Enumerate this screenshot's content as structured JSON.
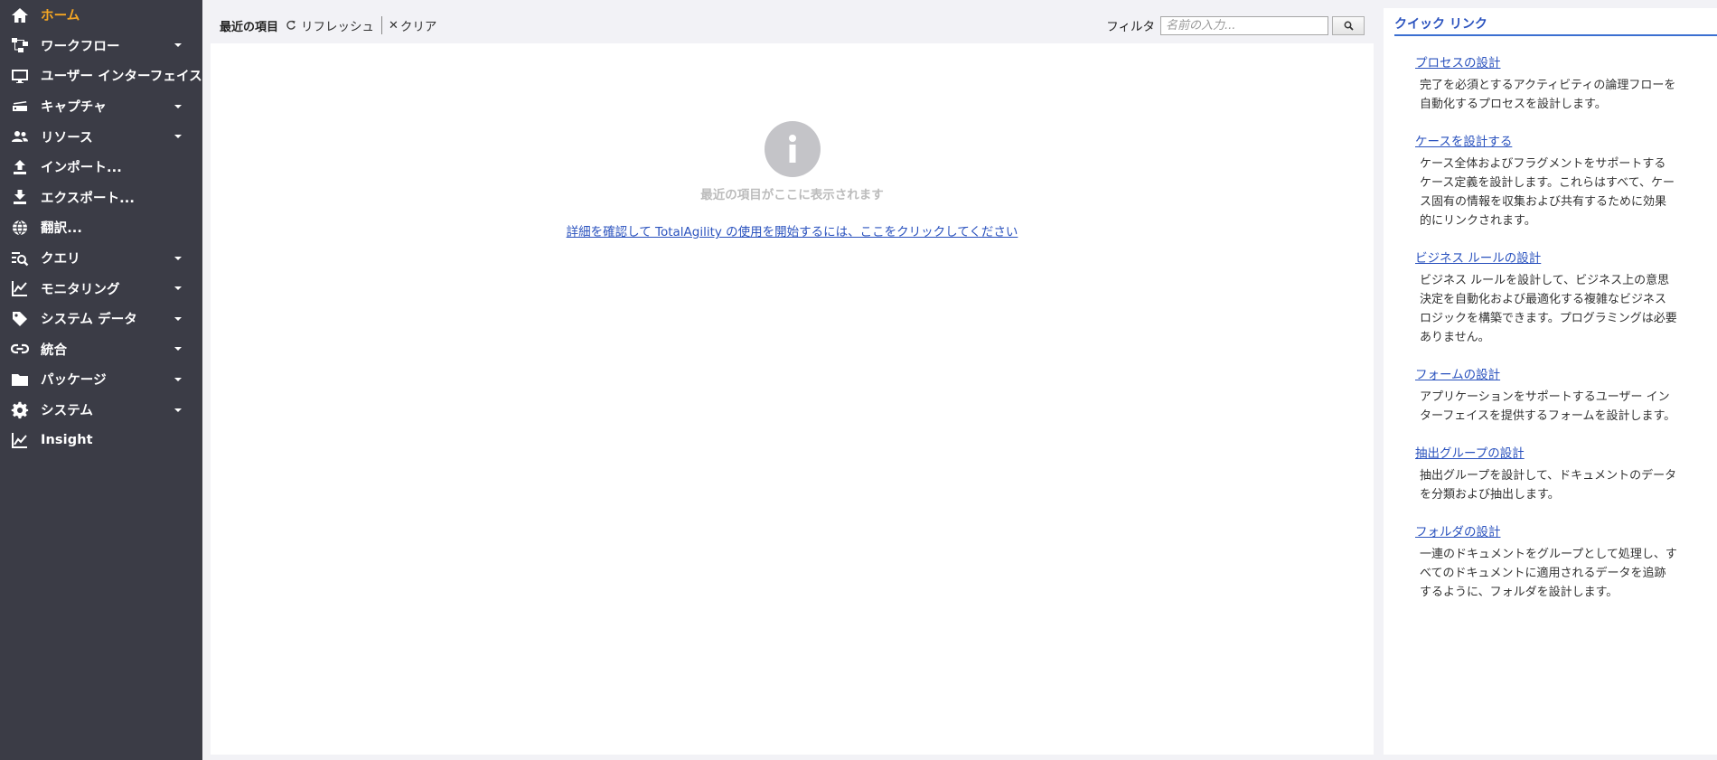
{
  "sidebar": {
    "items": [
      {
        "label": "ホーム",
        "icon": "home-icon",
        "active": true,
        "has_caret": false
      },
      {
        "label": "ワークフロー",
        "icon": "workflow-icon",
        "active": false,
        "has_caret": true
      },
      {
        "label": "ユーザー インターフェイス",
        "icon": "monitor-icon",
        "active": false,
        "has_caret": false
      },
      {
        "label": "キャプチャ",
        "icon": "scanner-icon",
        "active": false,
        "has_caret": true
      },
      {
        "label": "リソース",
        "icon": "people-icon",
        "active": false,
        "has_caret": true
      },
      {
        "label": "インポート...",
        "icon": "upload-icon",
        "active": false,
        "has_caret": false
      },
      {
        "label": "エクスポート...",
        "icon": "download-icon",
        "active": false,
        "has_caret": false
      },
      {
        "label": "翻訳...",
        "icon": "globe-icon",
        "active": false,
        "has_caret": false
      },
      {
        "label": "クエリ",
        "icon": "query-icon",
        "active": false,
        "has_caret": true
      },
      {
        "label": "モニタリング",
        "icon": "chart-line-icon",
        "active": false,
        "has_caret": true
      },
      {
        "label": "システム データ",
        "icon": "tag-icon",
        "active": false,
        "has_caret": true
      },
      {
        "label": "統合",
        "icon": "link-icon",
        "active": false,
        "has_caret": true
      },
      {
        "label": "パッケージ",
        "icon": "folder-icon",
        "active": false,
        "has_caret": true
      },
      {
        "label": "システム",
        "icon": "gear-icon",
        "active": false,
        "has_caret": true
      },
      {
        "label": "Insight",
        "icon": "insight-icon",
        "active": false,
        "has_caret": false
      }
    ]
  },
  "toolbar": {
    "title": "最近の項目",
    "refresh_label": "リフレッシュ",
    "clear_label": "クリア",
    "filter_label": "フィルタ",
    "filter_placeholder": "名前の入力...",
    "filter_value": ""
  },
  "main": {
    "empty_text": "最近の項目がここに表示されます",
    "help_link": "詳細を確認して TotalAgility の使用を開始するには、ここをクリックしてください"
  },
  "quick_links": {
    "title": "クイック リンク",
    "items": [
      {
        "link": "プロセスの設計",
        "desc": "完了を必須とするアクティビティの論理フローを自動化するプロセスを設計します。"
      },
      {
        "link": "ケースを設計する",
        "desc": "ケース全体およびフラグメントをサポートするケース定義を設計します。これらはすべて、ケース固有の情報を収集および共有するために効果的にリンクされます。"
      },
      {
        "link": "ビジネス ルールの設計",
        "desc": "ビジネス ルールを設計して、ビジネス上の意思決定を自動化および最適化する複雑なビジネス ロジックを構築できます。プログラミングは必要ありません。"
      },
      {
        "link": "フォームの設計",
        "desc": "アプリケーションをサポートするユーザー インターフェイスを提供するフォームを設計します。"
      },
      {
        "link": "抽出グループの設計",
        "desc": "抽出グループを設計して、ドキュメントのデータを分類および抽出します。"
      },
      {
        "link": "フォルダの設計",
        "desc": "一連のドキュメントをグループとして処理し、すべてのドキュメントに適用されるデータを追跡するように、フォルダを設計します。"
      }
    ]
  },
  "colors": {
    "sidebar_bg": "#3b3c46",
    "active_accent": "#f5a623",
    "link_blue": "#2a52be"
  }
}
